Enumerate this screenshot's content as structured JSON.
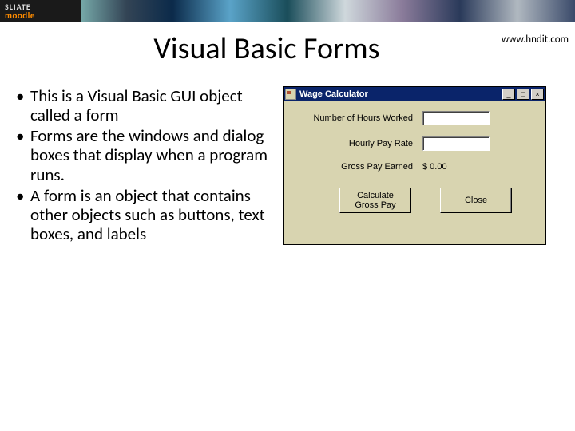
{
  "banner": {
    "line1": "SLIATE",
    "line2": "moodle"
  },
  "slide": {
    "title": "Visual Basic Forms",
    "site_url": "www.hndit.com",
    "bullets": [
      "This is a Visual Basic GUI object called a form",
      "Forms are the windows and dialog boxes that display when a program runs.",
      "A form is an object that contains other objects such as buttons, text boxes, and labels"
    ]
  },
  "vb_form": {
    "title": "Wage Calculator",
    "labels": {
      "hours": "Number of Hours Worked",
      "rate": "Hourly Pay Rate",
      "gross": "Gross Pay Earned"
    },
    "gross_value": "$ 0.00",
    "buttons": {
      "calc": "Calculate\nGross Pay",
      "close": "Close"
    },
    "win_controls": {
      "min": "_",
      "max": "□",
      "close": "×"
    }
  }
}
